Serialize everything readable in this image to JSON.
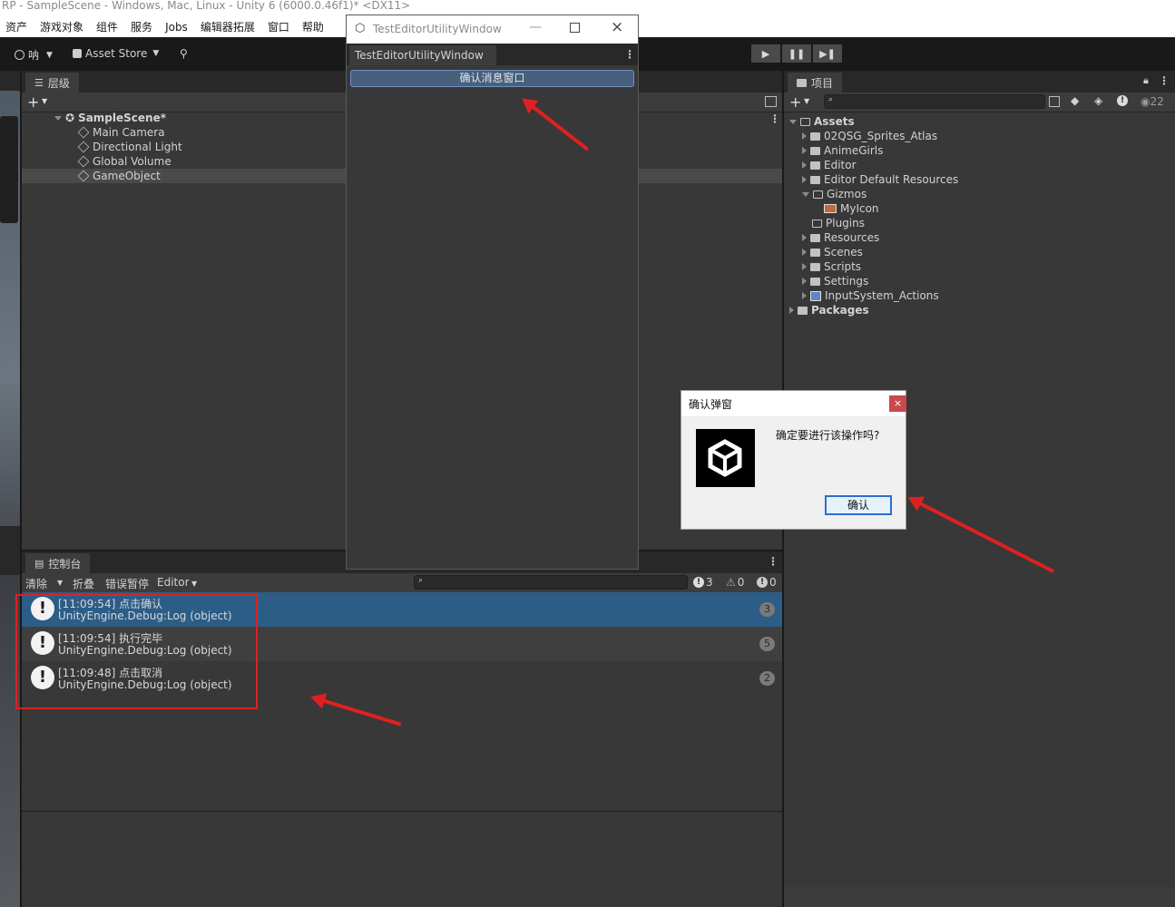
{
  "window_title": "RP - SampleScene - Windows, Mac, Linux - Unity 6 (6000.0.46f1)* <DX11>",
  "menu": [
    "资产",
    "游戏对象",
    "组件",
    "服务",
    "Jobs",
    "编辑器拓展",
    "窗口",
    "帮助"
  ],
  "toolbar": {
    "account": "呐",
    "asset_store": "Asset Store"
  },
  "hierarchy": {
    "tab": "层级",
    "scene": "SampleScene*",
    "items": [
      "Main Camera",
      "Directional Light",
      "Global Volume",
      "GameObject"
    ]
  },
  "utility_window": {
    "title": "TestEditorUtilityWindow",
    "tab": "TestEditorUtilityWindow",
    "button": "确认消息窗口"
  },
  "project": {
    "tab": "项目",
    "hidden_count": "22",
    "root": "Assets",
    "folders": [
      "02QSG_Sprites_Atlas",
      "AnimeGirls",
      "Editor",
      "Editor Default Resources",
      "Gizmos",
      "MyIcon",
      "Plugins",
      "Resources",
      "Scenes",
      "Scripts",
      "Settings",
      "InputSystem_Actions"
    ],
    "packages": "Packages"
  },
  "dialog": {
    "title": "确认弹窗",
    "close": "×",
    "message": "确定要进行该操作吗?",
    "confirm": "确认"
  },
  "console": {
    "tab": "控制台",
    "clear": "清除",
    "collapse": "折叠",
    "error_pause": "错误暂停",
    "editor": "Editor",
    "log_count": "3",
    "warn_count": "0",
    "error_count": "0",
    "entries": [
      {
        "line1": "[11:09:54] 点击确认",
        "line2": "UnityEngine.Debug:Log (object)",
        "count": "3"
      },
      {
        "line1": "[11:09:54] 执行完毕",
        "line2": "UnityEngine.Debug:Log (object)",
        "count": "5"
      },
      {
        "line1": "[11:09:48] 点击取消",
        "line2": "UnityEngine.Debug:Log (object)",
        "count": "2"
      }
    ]
  },
  "colors": {
    "selection": "#2c5d87",
    "panel": "#383838",
    "highlight_box": "#e02020"
  }
}
